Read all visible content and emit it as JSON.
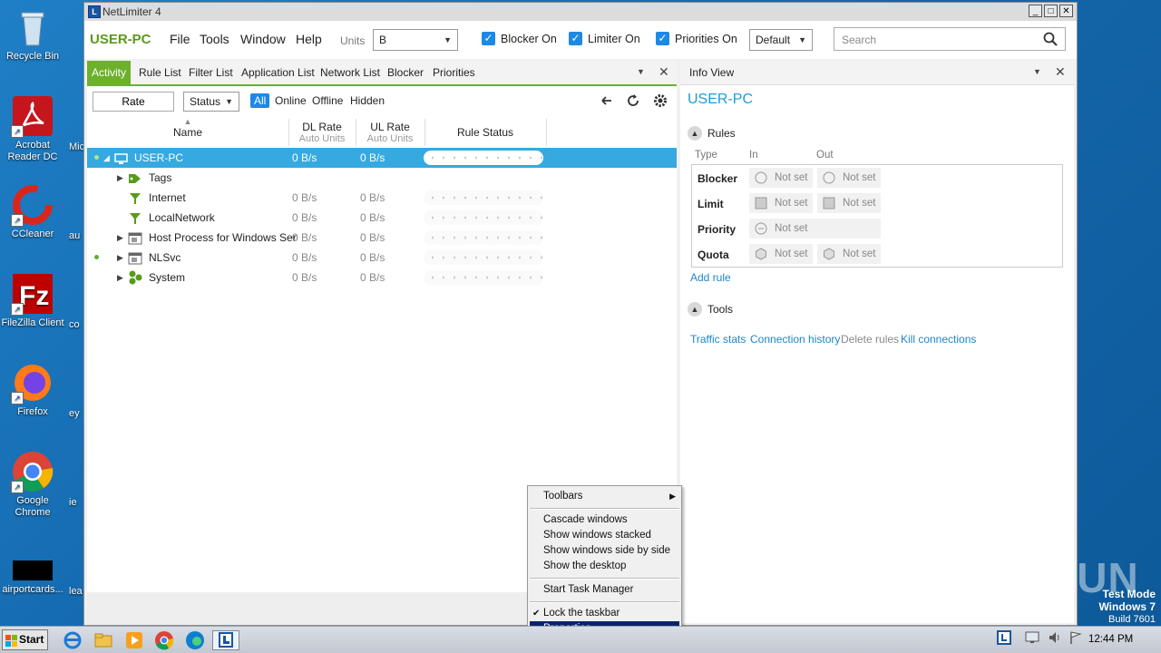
{
  "desktop": {
    "icons": [
      {
        "label": "Recycle Bin"
      },
      {
        "label": "Acrobat Reader DC"
      },
      {
        "label": "CCleaner"
      },
      {
        "label": "FileZilla Client"
      },
      {
        "label": "Firefox"
      },
      {
        "label": "Google Chrome"
      },
      {
        "label": "airportcards..."
      }
    ],
    "partial_labels": [
      "Mic",
      "au",
      "co",
      "ey",
      "ie",
      "lea"
    ]
  },
  "window": {
    "title": "NetLimiter 4",
    "min": "_",
    "max": "□",
    "close": "✕"
  },
  "toolbar": {
    "brand": "USER-PC",
    "menus": [
      "File",
      "Tools",
      "Window",
      "Help"
    ],
    "units_label": "Units",
    "units_value": "B",
    "blocker": "Blocker On",
    "limiter": "Limiter On",
    "priorities": "Priorities On",
    "profile": "Default",
    "search_placeholder": "Search"
  },
  "left_panel": {
    "tabs": [
      "Activity",
      "Rule List",
      "Filter List",
      "Application List",
      "Network List",
      "Blocker",
      "Priorities"
    ],
    "rate_btn": "Rate",
    "status_select": "Status",
    "filters": [
      "All",
      "Online",
      "Offline",
      "Hidden"
    ],
    "columns": {
      "name": "Name",
      "dl": "DL Rate",
      "dl_sub": "Auto Units",
      "ul": "UL Rate",
      "ul_sub": "Auto Units",
      "rule_status": "Rule Status"
    },
    "rows": [
      {
        "name": "USER-PC",
        "dl": "0 B/s",
        "ul": "0 B/s"
      },
      {
        "name": "Tags",
        "dl": "",
        "ul": ""
      },
      {
        "name": "Internet",
        "dl": "0 B/s",
        "ul": "0 B/s"
      },
      {
        "name": "LocalNetwork",
        "dl": "0 B/s",
        "ul": "0 B/s"
      },
      {
        "name": "Host Process for Windows Ser",
        "dl": "0 B/s",
        "ul": "0 B/s"
      },
      {
        "name": "NLSvc",
        "dl": "0 B/s",
        "ul": "0 B/s"
      },
      {
        "name": "System",
        "dl": "0 B/s",
        "ul": "0 B/s"
      }
    ]
  },
  "info_view": {
    "header": "Info View",
    "title": "USER-PC",
    "rules_section": "Rules",
    "type_col": "Type",
    "in_col": "In",
    "out_col": "Out",
    "rules": {
      "blocker": "Blocker",
      "limit": "Limit",
      "priority": "Priority",
      "quota": "Quota",
      "not_set": "Not set"
    },
    "add_rule": "Add rule",
    "tools_section": "Tools",
    "tools": [
      "Traffic stats",
      "Connection history",
      "Delete rules",
      "Kill connections"
    ]
  },
  "context_menu": {
    "items": [
      "Toolbars",
      "Cascade windows",
      "Show windows stacked",
      "Show windows side by side",
      "Show the desktop",
      "Start Task Manager",
      "Lock the taskbar",
      "Properties"
    ]
  },
  "taskbar": {
    "start": "Start",
    "clock": "12:44 PM"
  },
  "overlay": {
    "watermark": "ANY RUN",
    "test_mode": "Test Mode",
    "os": "Windows 7",
    "build": "Build 7601"
  }
}
